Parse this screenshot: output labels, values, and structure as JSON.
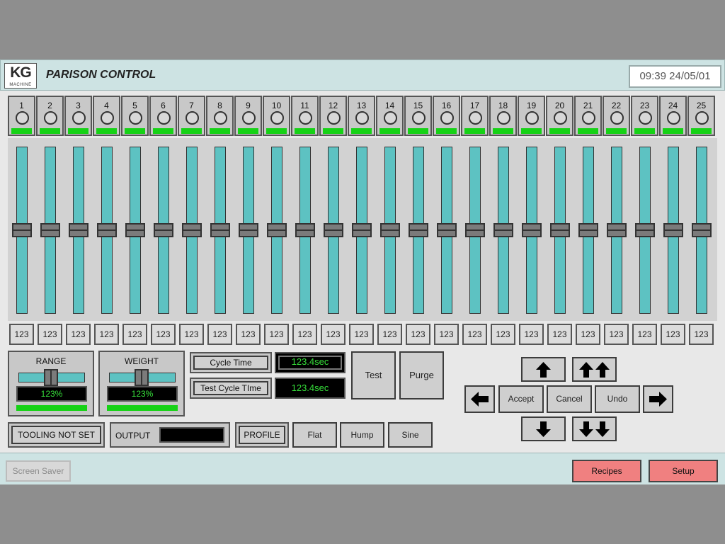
{
  "header": {
    "logo_text": "KG",
    "logo_sub": "MACHINE",
    "title": "PARISON CONTROL",
    "clock": "09:39 24/05/01"
  },
  "zones": [
    "1",
    "2",
    "3",
    "4",
    "5",
    "6",
    "7",
    "8",
    "9",
    "10",
    "11",
    "12",
    "13",
    "14",
    "15",
    "16",
    "17",
    "18",
    "19",
    "20",
    "21",
    "22",
    "23",
    "24",
    "25"
  ],
  "slider_values": [
    "123",
    "123",
    "123",
    "123",
    "123",
    "123",
    "123",
    "123",
    "123",
    "123",
    "123",
    "123",
    "123",
    "123",
    "123",
    "123",
    "123",
    "123",
    "123",
    "123",
    "123",
    "123",
    "123",
    "123",
    "123"
  ],
  "slider_level": 0.5,
  "range": {
    "label": "RANGE",
    "value": "123%"
  },
  "weight": {
    "label": "WEIGHT",
    "value": "123%"
  },
  "cycle": {
    "cycle_time_label": "Cycle Time",
    "cycle_time_value": "123.4sec",
    "test_cycle_label": "Test Cycle TIme",
    "test_cycle_value": "123.4sec"
  },
  "actions": {
    "test": "Test",
    "purge": "Purge"
  },
  "tooling": {
    "status": "TOOLING NOT SET"
  },
  "output": {
    "label": "OUTPUT"
  },
  "profile": {
    "label": "PROFILE",
    "flat": "Flat",
    "hump": "Hump",
    "sine": "Sine"
  },
  "nav": {
    "accept": "Accept",
    "cancel": "Cancel",
    "undo": "Undo"
  },
  "footer": {
    "screen_saver": "Screen Saver",
    "recipes": "Recipes",
    "setup": "Setup"
  },
  "colors": {
    "led_green": "#16d216",
    "display_text": "#36e03a",
    "track": "#5dc2c2",
    "header_bg": "#cde3e3",
    "alert_button": "#f08080"
  }
}
